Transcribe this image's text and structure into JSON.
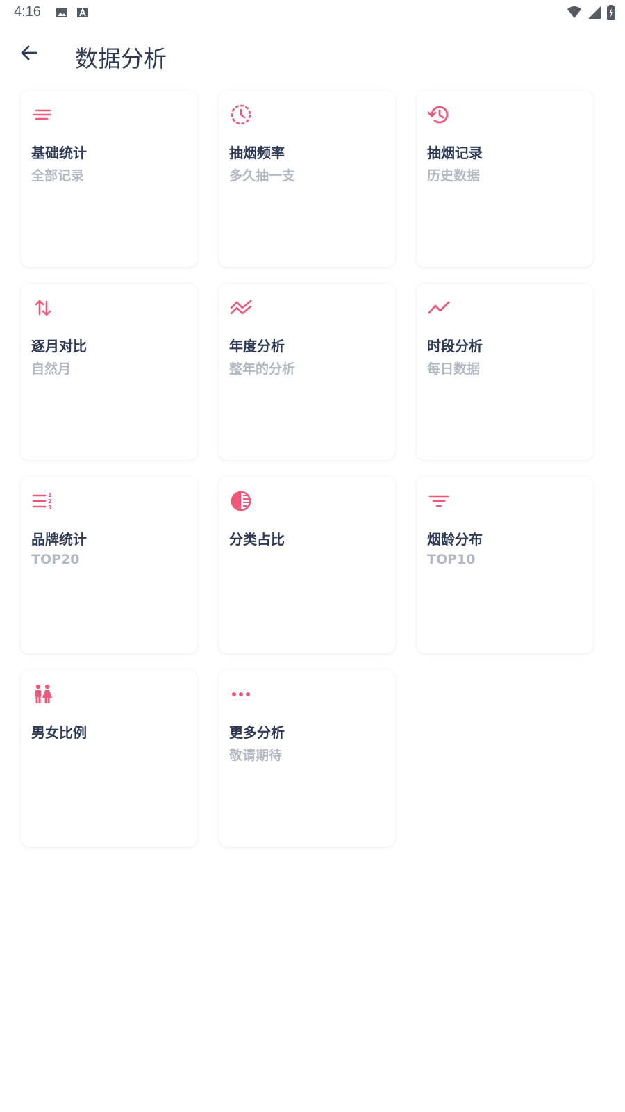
{
  "status_bar": {
    "time": "4:16"
  },
  "header": {
    "title": "数据分析"
  },
  "colors": {
    "accent": "#f2577a",
    "title_text": "#2f3a55",
    "subtitle_text": "#b3b8c3"
  },
  "cards": [
    {
      "title": "基础统计",
      "subtitle": "全部记录",
      "icon": "lines-icon"
    },
    {
      "title": "抽烟频率",
      "subtitle": "多久抽一支",
      "icon": "clock-icon"
    },
    {
      "title": "抽烟记录",
      "subtitle": "历史数据",
      "icon": "history-icon"
    },
    {
      "title": "逐月对比",
      "subtitle": "自然月",
      "icon": "swap-vertical-icon"
    },
    {
      "title": "年度分析",
      "subtitle": "整年的分析",
      "icon": "trend-zigzag-icon"
    },
    {
      "title": "时段分析",
      "subtitle": "每日数据",
      "icon": "line-chart-icon"
    },
    {
      "title": "品牌统计",
      "subtitle": "TOP20",
      "icon": "ranked-list-icon"
    },
    {
      "title": "分类占比",
      "subtitle": "",
      "icon": "contrast-circle-icon"
    },
    {
      "title": "烟龄分布",
      "subtitle": "TOP10",
      "icon": "filter-icon"
    },
    {
      "title": "男女比例",
      "subtitle": "",
      "icon": "man-woman-icon"
    },
    {
      "title": "更多分析",
      "subtitle": "敬请期待",
      "icon": "more-dots-icon"
    }
  ]
}
